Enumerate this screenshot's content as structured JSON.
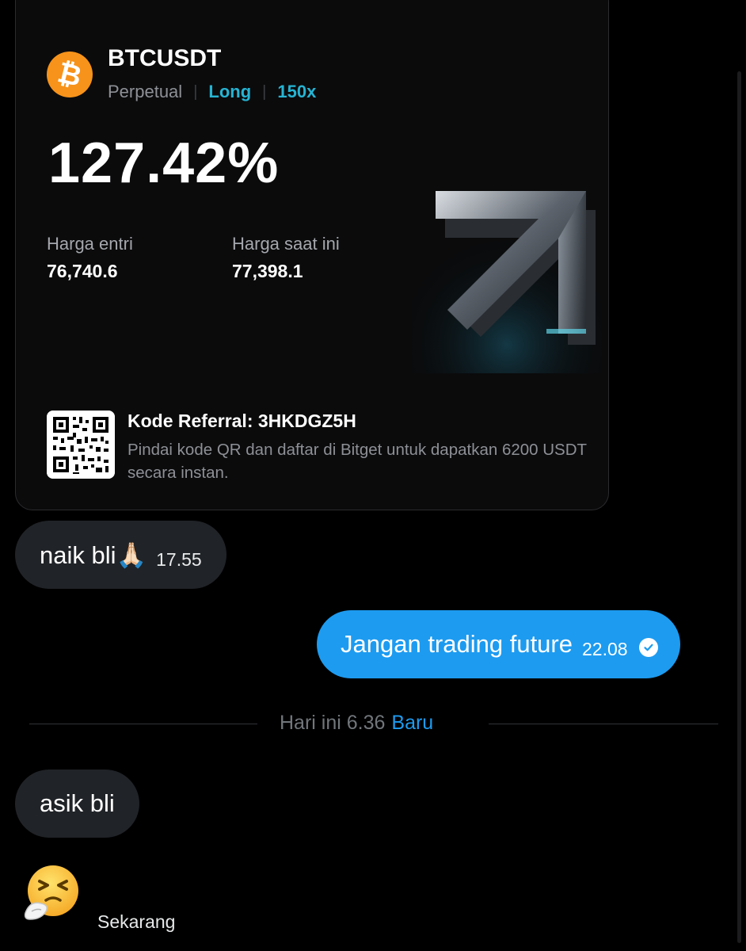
{
  "card": {
    "pair": "BTCUSDT",
    "contract_type": "Perpetual",
    "side": "Long",
    "leverage": "150x",
    "roi": "127.42%",
    "entry_label": "Harga entri",
    "entry_price": "76,740.6",
    "current_label": "Harga saat ini",
    "current_price": "77,398.1",
    "referral_title": "Kode Referral: 3HKDGZ5H",
    "referral_text": "Pindai kode QR dan daftar di Bitget untuk dapatkan 6200 USDT secara instan.",
    "coin_icon": "bitcoin-icon",
    "colors": {
      "coin": "#f7931a",
      "side": "#26b4d3"
    }
  },
  "chat": {
    "messages": [
      {
        "text": "naik bli🙏🏻",
        "time": "17.55",
        "direction": "incoming"
      },
      {
        "text": "Jangan trading future",
        "time": "22.08",
        "direction": "outgoing"
      }
    ],
    "divider": {
      "label": "Hari ini 6.36",
      "badge": "Baru"
    },
    "messages_after": [
      {
        "text": "asik bli",
        "direction": "incoming"
      }
    ],
    "reaction": {
      "emoji": "sneezing-face",
      "time": "Sekarang"
    },
    "colors": {
      "outgoing_bubble": "#1d9bf0",
      "incoming_bubble": "#202327"
    }
  }
}
